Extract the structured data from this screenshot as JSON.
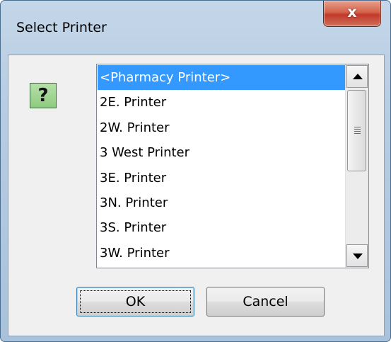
{
  "window": {
    "title": "Select Printer",
    "close_glyph": "x"
  },
  "icon": {
    "name": "question-icon",
    "glyph": "?"
  },
  "printers": [
    "<Pharmacy Printer>",
    "2E. Printer",
    "2W. Printer",
    "3 West Printer",
    "3E. Printer",
    "3N. Printer",
    "3S. Printer",
    "3W. Printer"
  ],
  "selected_index": 0,
  "buttons": {
    "ok_label": "OK",
    "cancel_label": "Cancel"
  },
  "colors": {
    "selection": "#3399ff",
    "close_button": "#c1392a",
    "help_icon": "#8fcb80"
  }
}
